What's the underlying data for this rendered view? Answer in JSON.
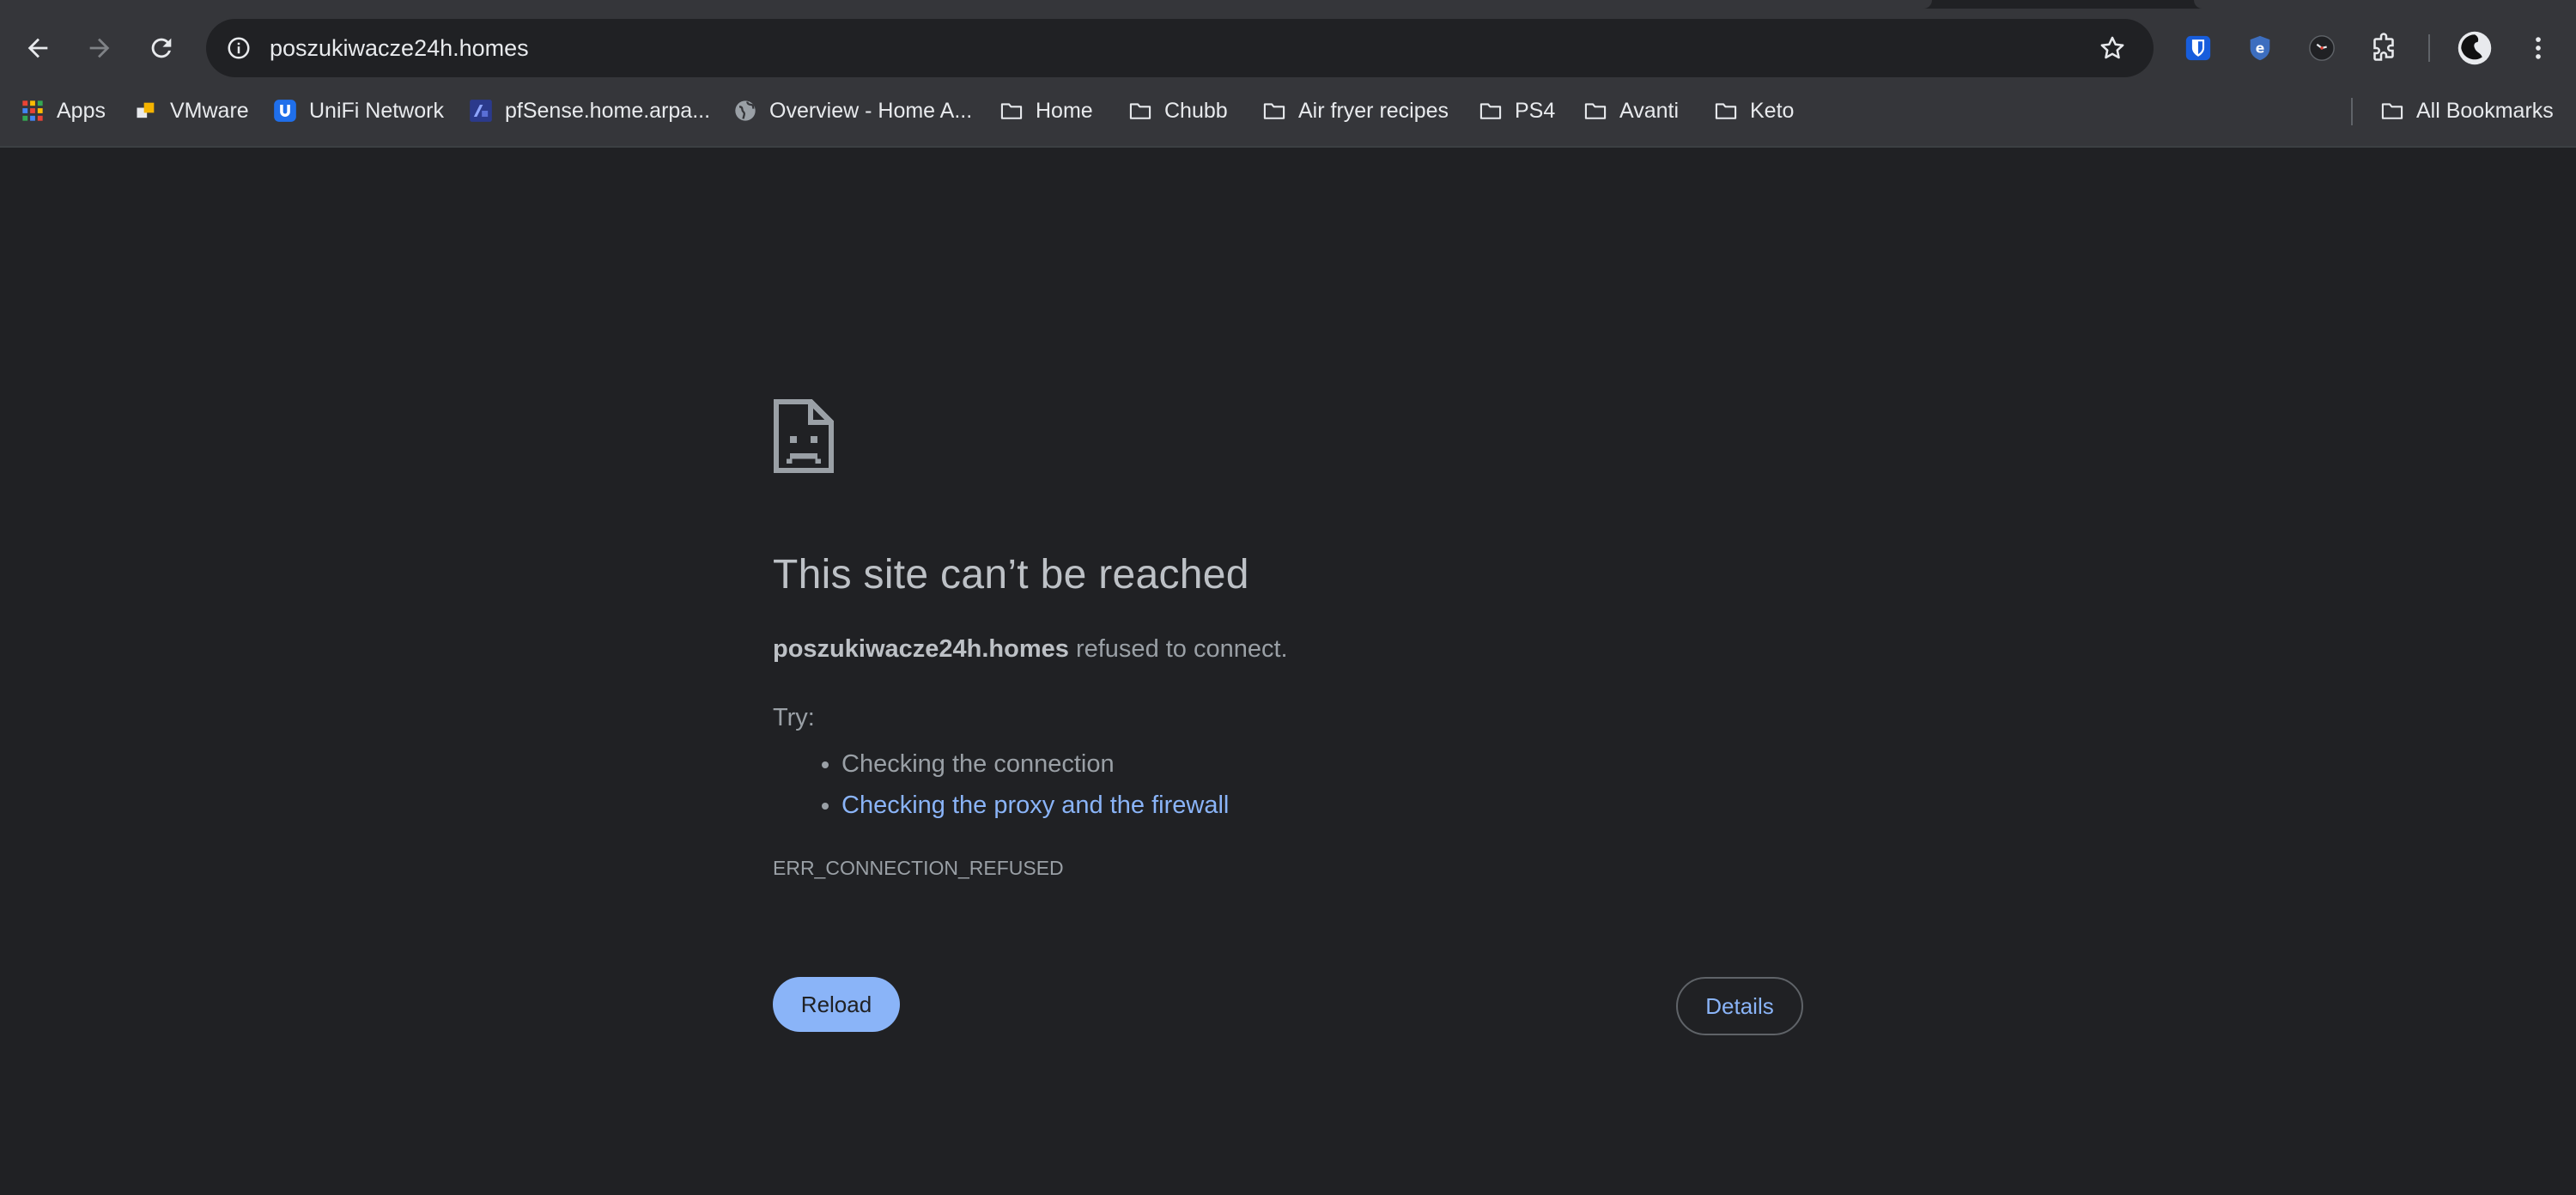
{
  "toolbar": {
    "url": "poszukiwacze24h.homes",
    "back_icon": "arrow-left-icon",
    "forward_icon": "arrow-right-icon",
    "reload_icon": "reload-icon",
    "site_info_icon": "info-icon",
    "bookmark_star_icon": "star-icon",
    "extensions": [
      "bitwarden-icon",
      "ublock-icon",
      "extension-clock-icon",
      "puzzle-icon"
    ],
    "profile_icon": "avatar",
    "menu_icon": "kebab-menu-icon"
  },
  "bookmarks": {
    "items": [
      {
        "label": "Apps",
        "icon": "apps-grid-icon"
      },
      {
        "label": "VMware",
        "icon": "vmware-icon"
      },
      {
        "label": "UniFi Network",
        "icon": "unifi-icon"
      },
      {
        "label": "pfSense.home.arpa...",
        "icon": "pfsense-icon"
      },
      {
        "label": "Overview - Home A...",
        "icon": "globe-icon"
      },
      {
        "label": "Home",
        "icon": "folder-icon"
      },
      {
        "label": "Chubb",
        "icon": "folder-icon"
      },
      {
        "label": "Air fryer recipes",
        "icon": "folder-icon"
      },
      {
        "label": "PS4",
        "icon": "folder-icon"
      },
      {
        "label": "Avanti",
        "icon": "folder-icon"
      },
      {
        "label": "Keto",
        "icon": "folder-icon"
      }
    ],
    "all_bookmarks": "All Bookmarks"
  },
  "error": {
    "icon": "sad-page-icon",
    "title": "This site can’t be reached",
    "host": "poszukiwacze24h.homes",
    "desc_suffix": " refused to connect.",
    "try_label": "Try:",
    "suggestion_1": "Checking the connection",
    "suggestion_2": "Checking the proxy and the firewall",
    "code": "ERR_CONNECTION_REFUSED",
    "reload_label": "Reload",
    "details_label": "Details"
  },
  "colors": {
    "page_bg": "#202124",
    "chrome_bg": "#35363a",
    "link": "#8ab4f8",
    "button_bg": "#8ab4f8"
  }
}
